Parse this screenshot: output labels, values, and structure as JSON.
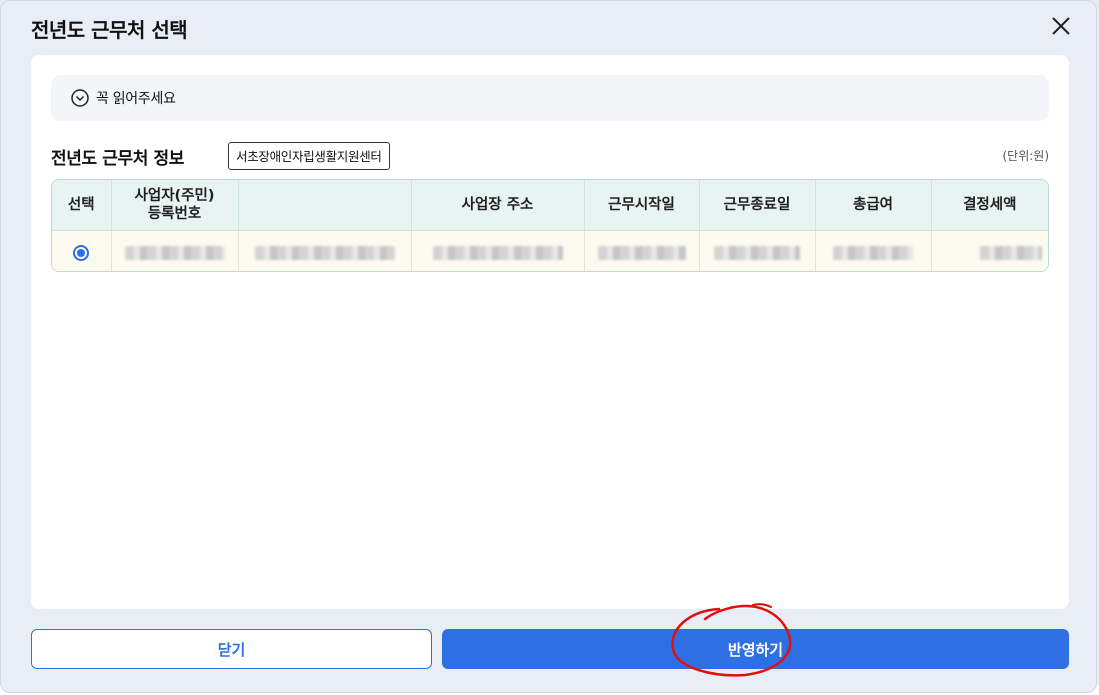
{
  "modal": {
    "title": "전년도 근무처 선택",
    "close_icon": "close-icon"
  },
  "notice": {
    "icon": "chevron-down-circle-icon",
    "label": "꼭 읽어주세요"
  },
  "section": {
    "title": "전년도 근무처 정보",
    "unit": "(단위:원)"
  },
  "table": {
    "headers": [
      "선택",
      "사업자(주민)\n등록번호",
      "",
      "사업장 주소",
      "근무시작일",
      "근무종료일",
      "총급여",
      "결정세액"
    ],
    "row": {
      "selected": true,
      "redacted": true
    }
  },
  "tooltip": {
    "text": "서초장애인자립생활지원센터"
  },
  "buttons": {
    "close_label": "닫기",
    "apply_label": "반영하기"
  },
  "colors": {
    "accent": "#2f6fe4",
    "annotation": "#e01010",
    "table_border": "#b9dcd4",
    "header_bg": "#e8f4f1",
    "row_bg": "#fdfbf0"
  }
}
